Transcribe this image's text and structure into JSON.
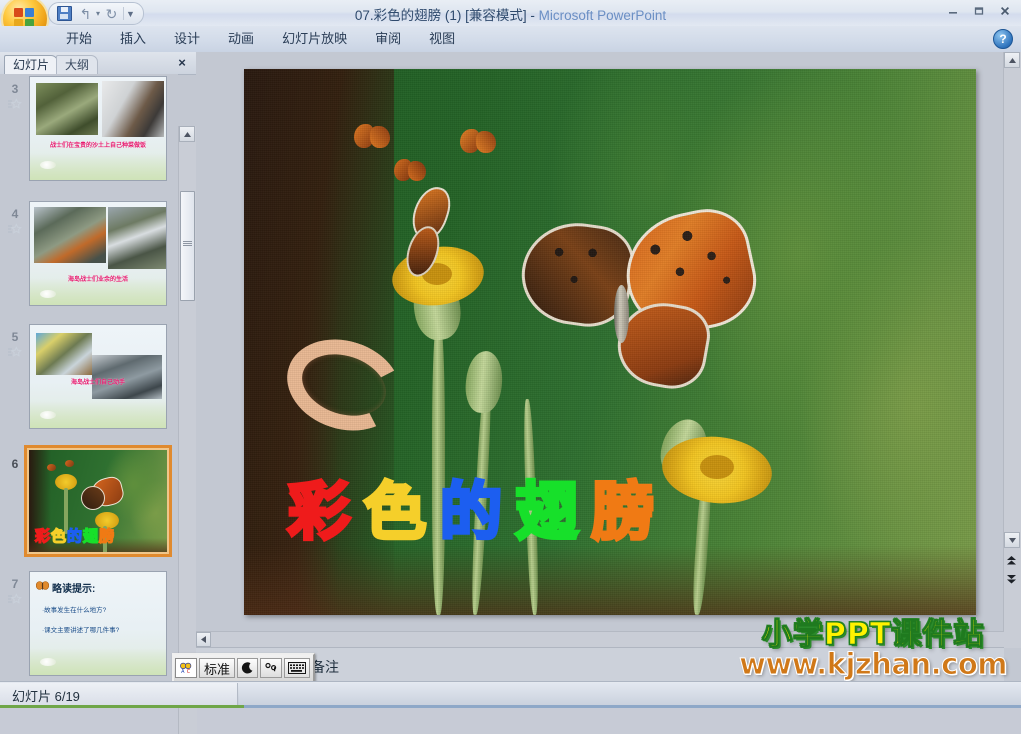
{
  "window": {
    "title_doc": "07.彩色的翅膀 (1) [兼容模式]",
    "title_sep": " - ",
    "title_app": "Microsoft PowerPoint",
    "minimize_label": "最小化",
    "restore_label": "还原",
    "close_label": "关闭"
  },
  "quick_access": {
    "save_label": "保存",
    "undo_label": "撤消",
    "redo_label": "恢复",
    "customize_label": "自定义快速访问工具栏"
  },
  "office_button": {
    "label": "Office 按钮"
  },
  "ribbon": {
    "tabs": [
      {
        "label": "开始",
        "active": false
      },
      {
        "label": "插入",
        "active": false
      },
      {
        "label": "设计",
        "active": false
      },
      {
        "label": "动画",
        "active": false
      },
      {
        "label": "幻灯片放映",
        "active": false
      },
      {
        "label": "审阅",
        "active": false
      },
      {
        "label": "视图",
        "active": false
      }
    ],
    "help_label": "?"
  },
  "left_panel": {
    "tabs": [
      {
        "label": "幻灯片",
        "active": true
      },
      {
        "label": "大纲",
        "active": false
      }
    ],
    "close_label": "×",
    "thumbnails": [
      {
        "number": "3",
        "selected": false,
        "caption": "战士们在宝贵的沙土上自己种菜做饭",
        "has_animation": true
      },
      {
        "number": "4",
        "selected": false,
        "caption": "海岛战士们业余的生活",
        "has_animation": true
      },
      {
        "number": "5",
        "selected": false,
        "caption": "海岛战士们自己动手",
        "has_animation": true
      },
      {
        "number": "6",
        "selected": true,
        "caption": "",
        "title_chars": [
          "彩",
          "色",
          "的",
          "翅",
          "膀"
        ],
        "has_animation": false
      },
      {
        "number": "7",
        "selected": false,
        "heading": "略读提示:",
        "bullets": [
          "·故事发生在什么地方?",
          "·课文主要讲述了哪几件事?"
        ],
        "has_animation": true
      }
    ]
  },
  "slide": {
    "title_chars": [
      {
        "char": "彩",
        "color": "#ef1b1b"
      },
      {
        "char": "色",
        "color": "#f5cf2a"
      },
      {
        "char": "的",
        "color": "#1c5ef0"
      },
      {
        "char": "翅",
        "color": "#17e02a"
      },
      {
        "char": "膀",
        "color": "#f07a14"
      }
    ]
  },
  "notes": {
    "placeholder_visible": "加备注"
  },
  "ime_bar": {
    "logo_label": "中文输入法",
    "mode_label": "标准",
    "shape_label": "半角/全角",
    "punct_label": "中英文标点",
    "keyboard_label": "软键盘"
  },
  "statusbar": {
    "slide_indicator": "幻灯片 6/19"
  },
  "scroll": {
    "up_arrow": "▲",
    "down_arrow": "▼",
    "left_arrow": "◄",
    "prev_slide": "▲",
    "next_slide": "▼"
  },
  "watermark": {
    "line1": "小学PPT课件站",
    "line2": "www.kjzhan.com"
  },
  "colors": {
    "accent_orange": "#e08a2e",
    "caption_pink": "#e8196e",
    "title_blue": "#6b8fc4",
    "watermark_yellow": "#fff200",
    "watermark_orange": "#d07818"
  }
}
